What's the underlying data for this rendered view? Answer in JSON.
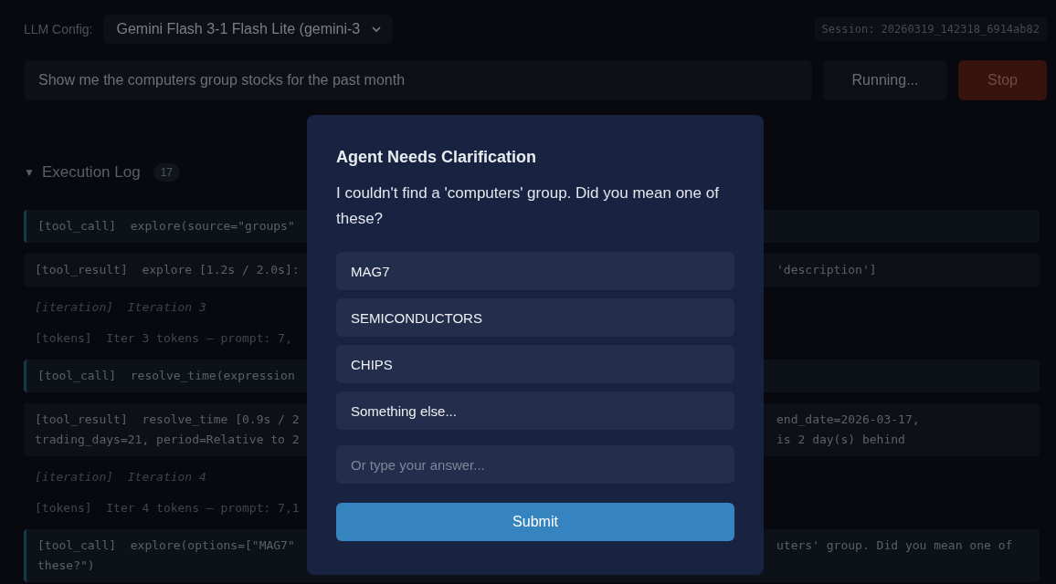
{
  "header": {
    "config_label": "LLM Config:",
    "model": "Gemini Flash 3-1 Flash Lite (gemini-3",
    "session": "Session: 20260319_142318_6914ab82"
  },
  "query": {
    "value": "Show me the computers group stocks for the past month",
    "run_button": "Running...",
    "run_disabled": true,
    "stop_button": "Stop"
  },
  "log": {
    "toggle": "▼",
    "title": "Execution Log",
    "count": "17",
    "expanded": true,
    "entries": [
      {
        "kind": "tool_call",
        "left": [
          "[tool_call]  explore(source=\"groups\""
        ]
      },
      {
        "kind": "tool_result",
        "left": [
          "[tool_result]  explore [1.2s / 2.0s]:"
        ],
        "right": [
          "'description']"
        ]
      },
      {
        "kind": "iteration",
        "left": [
          "[iteration]  Iteration 3"
        ]
      },
      {
        "kind": "tokens",
        "left": [
          "[tokens]  Iter 3 tokens — prompt: 7,"
        ]
      },
      {
        "kind": "tool_call",
        "left": [
          "[tool_call]  resolve_time(expression"
        ]
      },
      {
        "kind": "tool_result",
        "left": [
          "[tool_result]  resolve_time [0.9s / 2",
          "trading_days=21, period=Relative to 2"
        ],
        "right": [
          "end_date=2026-03-17,",
          "is 2 day(s) behind"
        ]
      },
      {
        "kind": "iteration",
        "left": [
          "[iteration]  Iteration 4"
        ]
      },
      {
        "kind": "tokens",
        "left": [
          "[tokens]  Iter 4 tokens — prompt: 7,1"
        ]
      },
      {
        "kind": "tool_call",
        "left": [
          "[tool_call]  explore(options=[\"MAG7\"",
          "these?\")"
        ],
        "right": [
          "uters' group. Did you mean one of"
        ]
      }
    ]
  },
  "dialog": {
    "title": "Agent Needs Clarification",
    "message": "I couldn't find a 'computers' group. Did you mean one of these?",
    "options": [
      "MAG7",
      "SEMICONDUCTORS",
      "CHIPS",
      "Something else..."
    ],
    "answer_placeholder": "Or type your answer...",
    "submit": "Submit"
  }
}
